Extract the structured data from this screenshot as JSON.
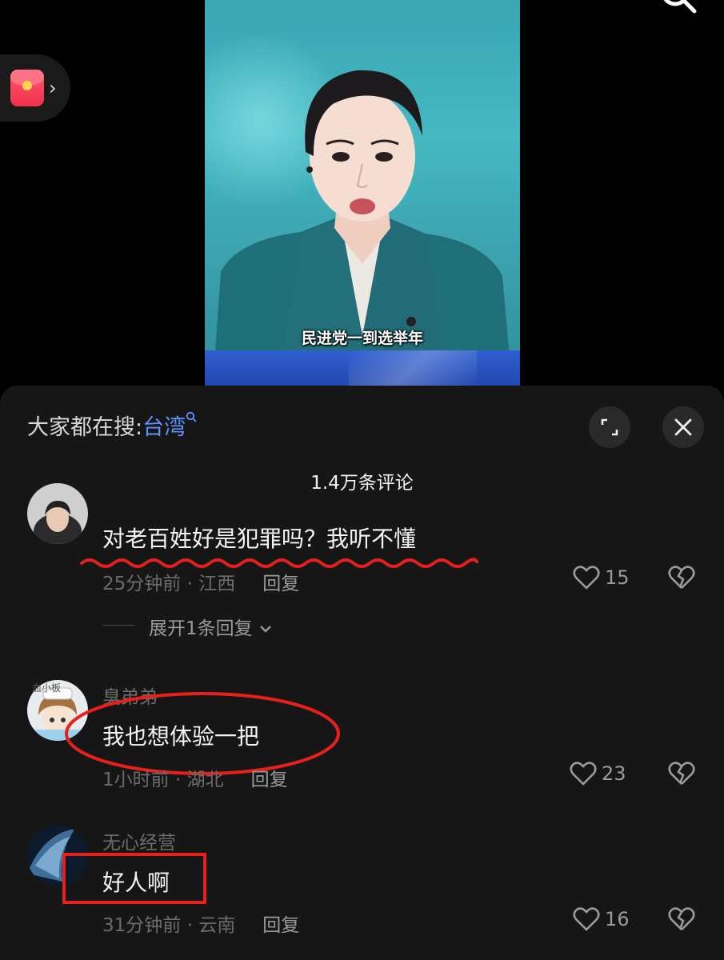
{
  "video": {
    "subtitle": "民进党一到选举年"
  },
  "panel": {
    "trend_prefix": "大家都在搜:",
    "trend_keyword": "台湾",
    "comment_count": "1.4万条评论"
  },
  "comments": [
    {
      "user": "",
      "text": "对老百姓好是犯罪吗？我听不懂",
      "time_location": "25分钟前 · 江西",
      "reply": "回复",
      "likes": "15",
      "expand": "展开1条回复"
    },
    {
      "user": "臭弟弟",
      "text": "我也想体验一把",
      "time_location": "1小时前 · 湖北",
      "reply": "回复",
      "likes": "23"
    },
    {
      "user": "无心经营",
      "text": "好人啊",
      "time_location": "31分钟前 · 云南",
      "reply": "回复",
      "likes": "16"
    }
  ],
  "avatar_badge": "血小板",
  "colors": {
    "annotation_red": "#e8201c",
    "keyword_blue": "#5d93ff",
    "panel_bg": "#161616"
  },
  "icons": [
    "red-packet-icon",
    "chevron-right-icon",
    "search-icon",
    "expand-icon",
    "close-icon",
    "heart-icon",
    "broken-heart-icon",
    "chevron-down-icon"
  ]
}
